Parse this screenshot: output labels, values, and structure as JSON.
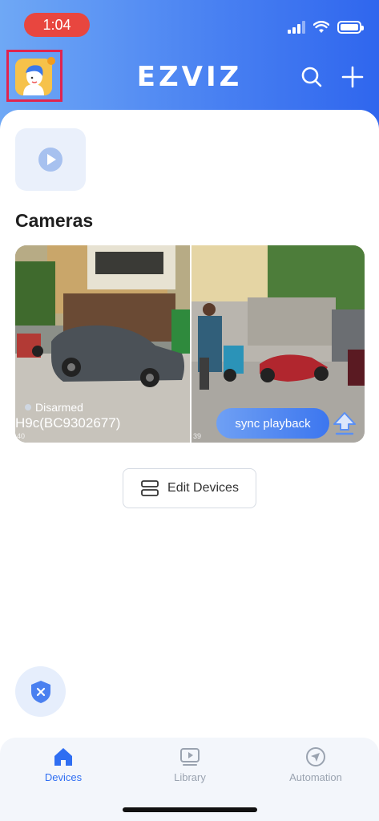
{
  "status_bar": {
    "time": "1:04"
  },
  "header": {
    "logo": "EZVIZ"
  },
  "section": {
    "title": "Cameras"
  },
  "cameras": [
    {
      "status": "Disarmed",
      "name": "H9c(BC9302677)",
      "timestamp": "40"
    },
    {
      "timestamp": "39"
    }
  ],
  "buttons": {
    "sync": "sync playback",
    "edit": "Edit Devices"
  },
  "tabs": [
    {
      "label": "Devices",
      "active": true
    },
    {
      "label": "Library",
      "active": false
    },
    {
      "label": "Automation",
      "active": false
    }
  ],
  "colors": {
    "accent": "#2f6ef2",
    "highlight_box": "#e0244f",
    "time_pill": "#e8463f"
  }
}
